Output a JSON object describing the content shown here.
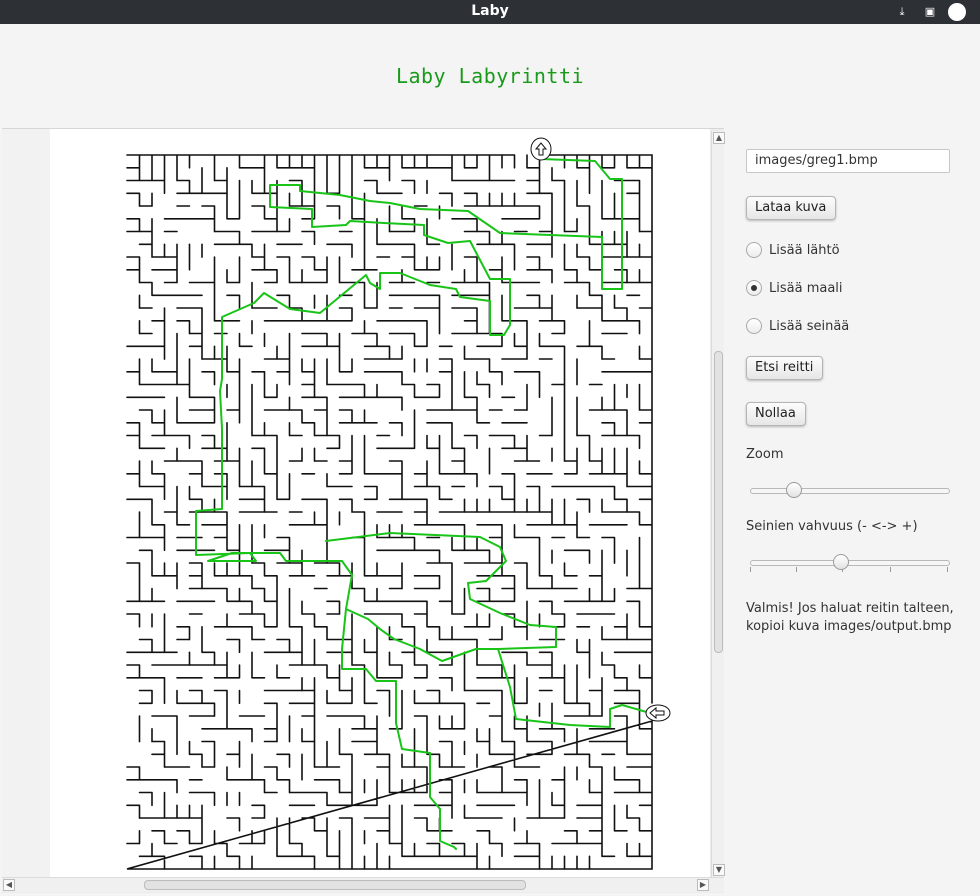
{
  "window": {
    "title": "Laby",
    "minimize_glyph": "⤓",
    "maximize_glyph": "▣"
  },
  "app": {
    "title": "Laby Labyrintti"
  },
  "panel": {
    "file_path": "images/greg1.bmp",
    "load_button": "Lataa kuva",
    "radio_start": "Lisää lähtö",
    "radio_goal": "Lisää maali",
    "radio_wall": "Lisää seinää",
    "selected_mode": "goal",
    "find_route_button": "Etsi reitti",
    "reset_button": "Nollaa",
    "zoom_label": "Zoom",
    "zoom_value": 0.22,
    "wall_label": "Seinien vahvuus (- <-> +)",
    "wall_value": 0.46,
    "status_line1": "Valmis! Jos haluat reitin talteen,",
    "status_line2": "kopioi kuva images/output.bmp"
  },
  "colors": {
    "route": "#18c418",
    "maze_wall": "#111111",
    "title_text": "#1a9a1a"
  },
  "icons": {
    "start_marker": "arrow-up-icon",
    "goal_marker": "arrow-left-icon"
  }
}
